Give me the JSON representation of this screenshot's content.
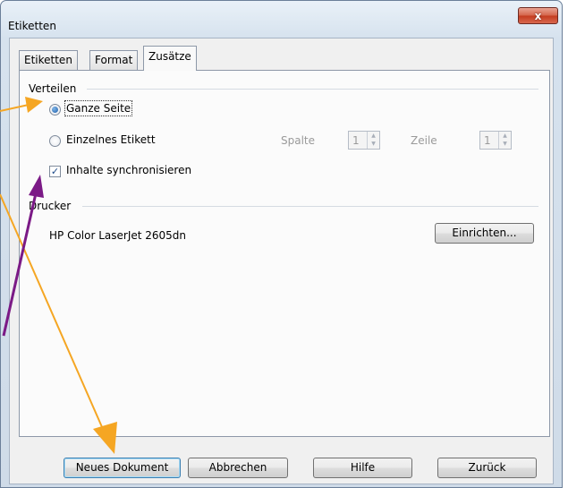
{
  "window": {
    "title": "Etiketten",
    "close_glyph": "x"
  },
  "tabs": [
    {
      "label": "Etiketten",
      "selected": false
    },
    {
      "label": "Format",
      "selected": false
    },
    {
      "label": "Zusätze",
      "selected": true
    }
  ],
  "verteilen": {
    "header": "Verteilen",
    "radio_ganze_seite": "Ganze Seite",
    "radio_einzelnes_etikett": "Einzelnes Etikett",
    "spalte_label": "Spalte",
    "spalte_value": "1",
    "zeile_label": "Zeile",
    "zeile_value": "1",
    "sync_checkbox": "Inhalte synchronisieren",
    "selected_option": "Ganze Seite",
    "sync_checked": true
  },
  "drucker": {
    "header": "Drucker",
    "printer_name": "HP Color LaserJet 2605dn",
    "setup_button": "Einrichten..."
  },
  "buttons": {
    "new_document": "Neues Dokument",
    "cancel": "Abbrechen",
    "help": "Hilfe",
    "back": "Zurück"
  },
  "colors": {
    "arrow_orange": "#f5a623",
    "arrow_purple": "#7b1a86",
    "close_red": "#c43b1f"
  }
}
